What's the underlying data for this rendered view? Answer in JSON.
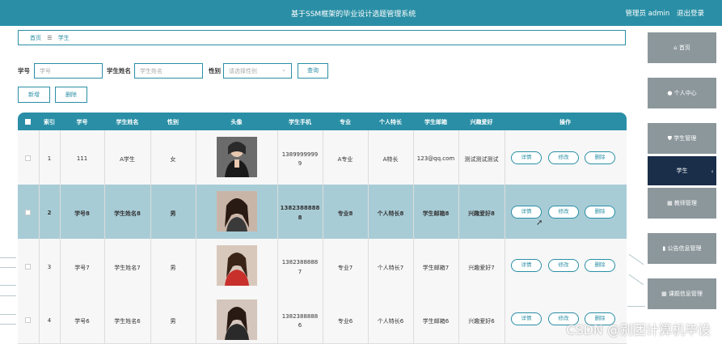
{
  "header": {
    "title": "基于SSM框架的毕业设计选题管理系统",
    "user_label": "管理员 admin",
    "logout": "退出登录"
  },
  "breadcrumb": {
    "home": "首页",
    "sep": "☰",
    "current": "学生"
  },
  "search": {
    "xuehao_label": "学号",
    "xuehao_placeholder": "学号",
    "name_label": "学生姓名",
    "name_placeholder": "学生姓名",
    "gender_label": "性别",
    "gender_placeholder": "请选择性别",
    "query_button": "查询"
  },
  "actions": {
    "add": "新增",
    "delete": "删除"
  },
  "table": {
    "headers": [
      "索引",
      "学号",
      "学生姓名",
      "性别",
      "头像",
      "学生手机",
      "专业",
      "个人特长",
      "学生邮箱",
      "兴趣爱好",
      "操作"
    ],
    "rows": [
      {
        "index": "1",
        "xuehao": "111",
        "name": "A学生",
        "gender": "女",
        "phone1": "1389999999",
        "phone2": "9",
        "major": "A专业",
        "special": "A特长",
        "email": "123@qq.com",
        "hobby": "测试测试测试"
      },
      {
        "index": "2",
        "xuehao": "学号8",
        "name": "学生姓名8",
        "gender": "男",
        "phone1": "1382388888",
        "phone2": "8",
        "major": "专业8",
        "special": "个人特长8",
        "email": "学生邮箱8",
        "hobby": "兴趣爱好8"
      },
      {
        "index": "3",
        "xuehao": "学号7",
        "name": "学生姓名7",
        "gender": "男",
        "phone1": "1382388888",
        "phone2": "7",
        "major": "专业7",
        "special": "个人特长7",
        "email": "学生邮箱7",
        "hobby": "兴趣爱好7"
      },
      {
        "index": "4",
        "xuehao": "学号6",
        "name": "学生姓名6",
        "gender": "男",
        "phone1": "1382388888",
        "phone2": "6",
        "major": "专业6",
        "special": "个人特长6",
        "email": "学生邮箱6",
        "hobby": "兴趣爱好6"
      }
    ],
    "ops": {
      "detail": "详情",
      "edit": "修改",
      "remove": "删除"
    }
  },
  "sidebar": {
    "items": [
      {
        "label": "首页",
        "icon": "home-icon"
      },
      {
        "label": "个人中心",
        "icon": "user-icon"
      },
      {
        "label": "学生管理",
        "icon": "shield-icon"
      },
      {
        "label": "学生",
        "icon": ""
      },
      {
        "label": "教师管理",
        "icon": "grid-icon"
      },
      {
        "label": "公告信息管理",
        "icon": "chart-icon"
      },
      {
        "label": "课题信息管理",
        "icon": "grid-icon"
      }
    ]
  },
  "watermark": "CSDN @别团计算机毕设",
  "colors": {
    "primary": "#2a8fa6",
    "sidebar": "#8c979c",
    "sidebar_active": "#1a2e4a",
    "highlight_row": "#a8ccd6"
  }
}
